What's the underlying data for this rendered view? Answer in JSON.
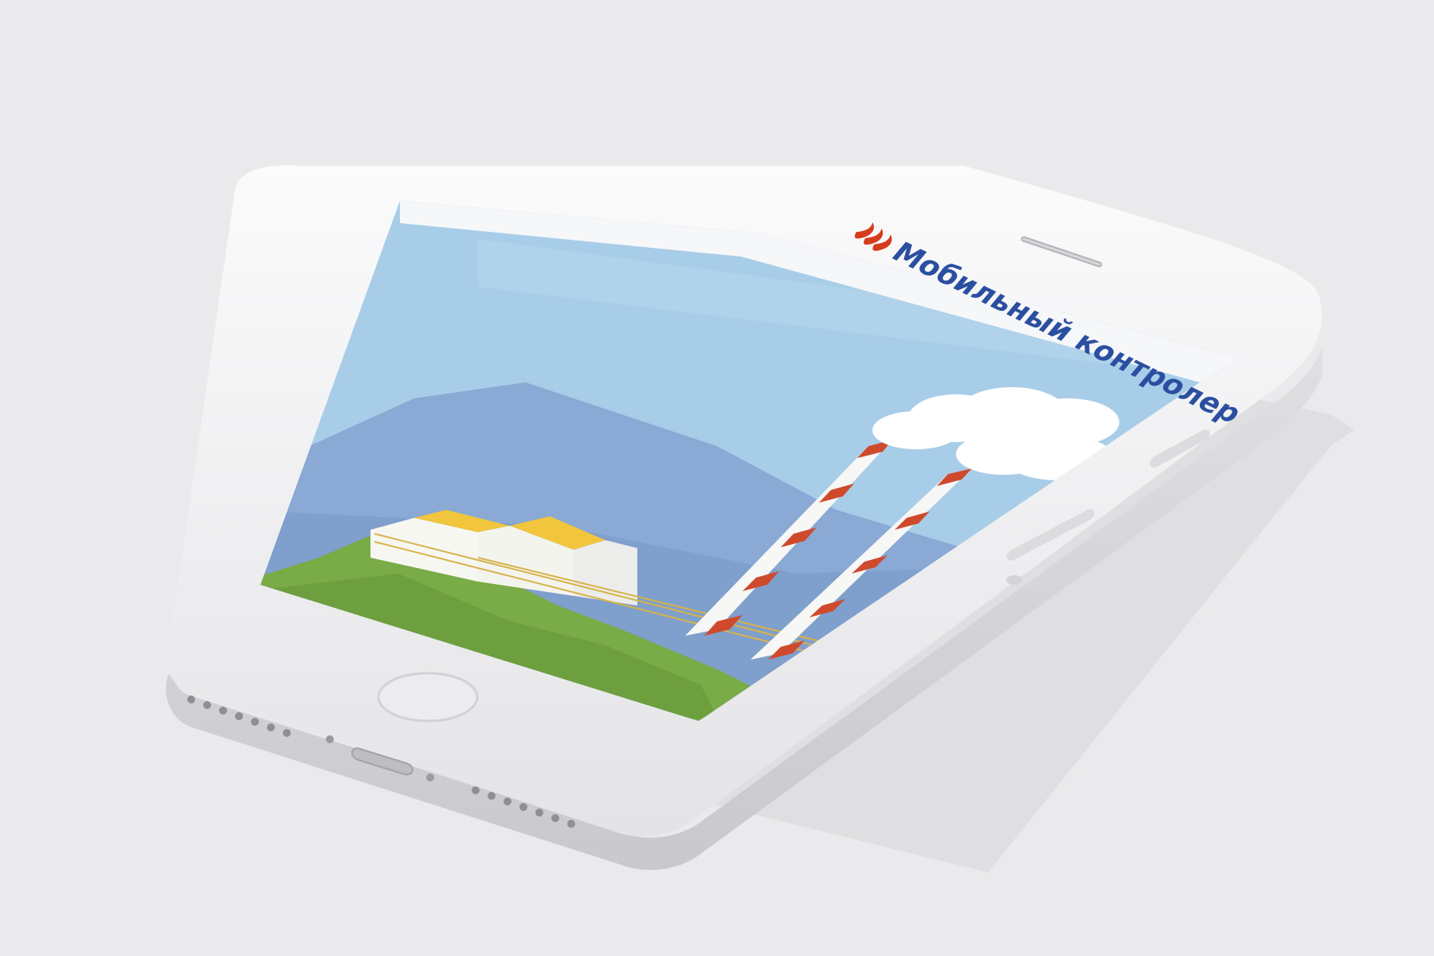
{
  "app": {
    "title": "Мобильный контролер",
    "logo_icon": "flame-logo-icon"
  },
  "screen": {
    "scene": "power-plant-illustration",
    "elements": [
      "sky",
      "mountains",
      "smokestacks",
      "smoke-clouds",
      "factory-buildings",
      "grass-field",
      "power-lines"
    ]
  },
  "device": {
    "type": "smartphone",
    "color": "white",
    "parts": [
      "earpiece-speaker",
      "home-button",
      "volume-up-button",
      "volume-down-button",
      "charging-port",
      "bottom-speaker-grilles"
    ]
  },
  "colors": {
    "background": "#eaeaec",
    "sky": "#a8cde8",
    "mountain": "#8aa9d4",
    "grass": "#79ab47",
    "stack_red": "#cf4a2c",
    "title_blue": "#2b4fa0",
    "logo_red": "#d63c1c"
  }
}
